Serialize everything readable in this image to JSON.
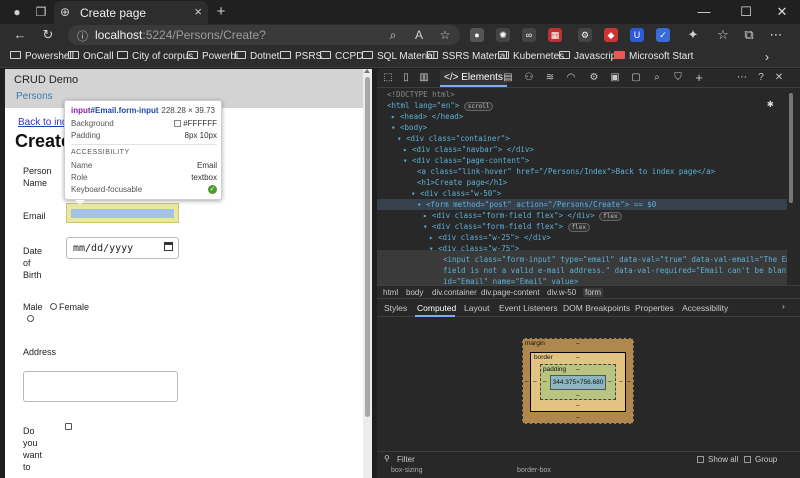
{
  "browser": {
    "tab_title": "Create page",
    "url_host": "localhost",
    "url_path": ":5224/Persons/Create?",
    "bookmarks": [
      "Powershell",
      "OnCall",
      "City of corpus",
      "Powerbi",
      "Dotnet",
      "PSRS",
      "CCPD",
      "SQL Material",
      "SSRS Material",
      "Kubernetes",
      "Javascript",
      "Microsoft Start"
    ]
  },
  "page": {
    "brand": "CRUD Demo",
    "nav_link": "Persons",
    "back_link": "Back to index page",
    "heading": "Create page",
    "labels": {
      "person_name": "Person Name",
      "email": "Email",
      "dob": "Date of Birth",
      "male": "Male",
      "female": "Female",
      "address": "Address",
      "question": "Do you want to"
    },
    "date_placeholder": "mm/dd/yyyy"
  },
  "tooltip": {
    "selector_tag": "input",
    "selector_id_class": "#Email.form-input",
    "dimensions": "228.28 × 39.73",
    "rows": [
      {
        "k": "Background",
        "v": "#FFFFFF"
      },
      {
        "k": "Padding",
        "v": "8px 10px"
      }
    ],
    "accessibility_header": "ACCESSIBILITY",
    "acc_rows": [
      {
        "k": "Name",
        "v": "Email"
      },
      {
        "k": "Role",
        "v": "textbox"
      },
      {
        "k": "Keyboard-focusable",
        "v": ""
      }
    ]
  },
  "devtools": {
    "active_tab": "Elements",
    "dom_lines": [
      "<!DOCTYPE html>",
      "<html lang=\"en\">",
      "<head> </head>",
      "<body>",
      "<div class=\"container\">",
      "<div class=\"navbar\"> </div>",
      "<div class=\"page-content\">",
      "<a class=\"link-hover\" href=\"/Persons/Index\">Back to index page</a>",
      "<h1>Create page</h1>",
      "<div class=\"w-50\">",
      "<form method=\"post\" action=\"/Persons/Create\"> == $0",
      "<div class=\"form-field flex\"> </div>",
      "<div class=\"form-field flex\">",
      "<div class=\"w-25\"> </div>",
      "<div class=\"w-75\">",
      "<input class=\"form-input\" type=\"email\" data-val=\"true\" data-val-email=\"The Email",
      "field is not a valid e-mail address.\" data-val-required=\"Email can't be blank\"",
      "id=\"Email\" name=\"Email\" value>"
    ],
    "breadcrumbs": [
      "html",
      "body",
      "div.container",
      "div.page-content",
      "div.w-50",
      "form"
    ],
    "subtabs": [
      "Styles",
      "Computed",
      "Layout",
      "Event Listeners",
      "DOM Breakpoints",
      "Properties",
      "Accessibility"
    ],
    "active_subtab": "Computed",
    "boxmodel": {
      "margin_label": "margin",
      "border_label": "border",
      "padding_label": "padding",
      "content": "344.375×756.680",
      "dash": "–"
    },
    "filter_placeholder": "Filter",
    "show_all": "Show all",
    "group": "Group",
    "bottom_props": [
      "box-sizing",
      "border-box"
    ]
  }
}
